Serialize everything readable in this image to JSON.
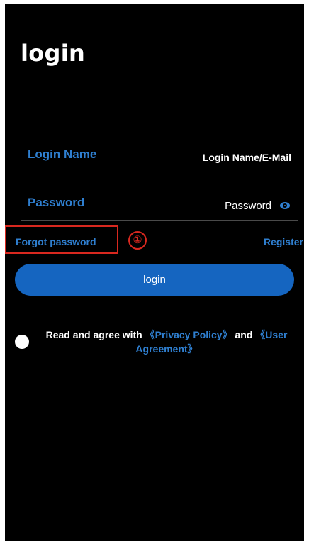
{
  "header": {
    "title": "login"
  },
  "form": {
    "login_name": {
      "label": "Login Name",
      "placeholder": "Login Name/E-Mail"
    },
    "password": {
      "label": "Password",
      "placeholder": "Password",
      "icon": "eye-icon"
    },
    "forgot_label": "Forgot password",
    "register_label": "Register",
    "submit_label": "login"
  },
  "annotation": {
    "marker": "①",
    "color": "#d9281f"
  },
  "agreement": {
    "prefix": "Read and agree with ",
    "privacy_link": "《Privacy Policy》",
    "and_text": " and ",
    "user_link": "《User Agreement》"
  },
  "colors": {
    "accent": "#2f7fd0",
    "button": "#1565c0",
    "background": "#000000"
  }
}
